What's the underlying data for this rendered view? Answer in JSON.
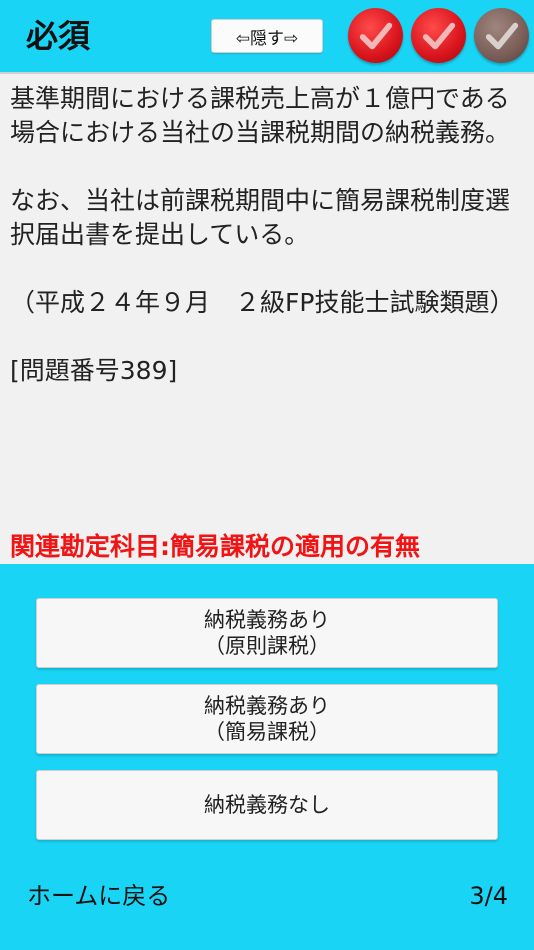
{
  "header": {
    "title": "必須",
    "hide_label": "⇦隠す⇨",
    "checks": [
      {
        "state": "correct",
        "color": "#d8141c"
      },
      {
        "state": "correct",
        "color": "#d8141c"
      },
      {
        "state": "pending",
        "color": "#7a5d57"
      }
    ]
  },
  "question": {
    "text": "基準期間における課税売上高が１億円である場合における当社の当課税期間の納税義務。\n\nなお、当社は前課税期間中に簡易課税制度選択届出書を提出している。\n\n（平成２４年９月　２級FP技能士試験類題）\n\n[問題番号389]",
    "related": "関連勘定科目:簡易課税の適用の有無",
    "related_color": "#f21414"
  },
  "answers": [
    {
      "line1": "納税義務あり",
      "line2": "（原則課税）"
    },
    {
      "line1": "納税義務あり",
      "line2": "（簡易課税）"
    },
    {
      "line1": "納税義務なし",
      "line2": ""
    }
  ],
  "footer": {
    "home_label": "ホームに戻る",
    "page": "3/4"
  }
}
